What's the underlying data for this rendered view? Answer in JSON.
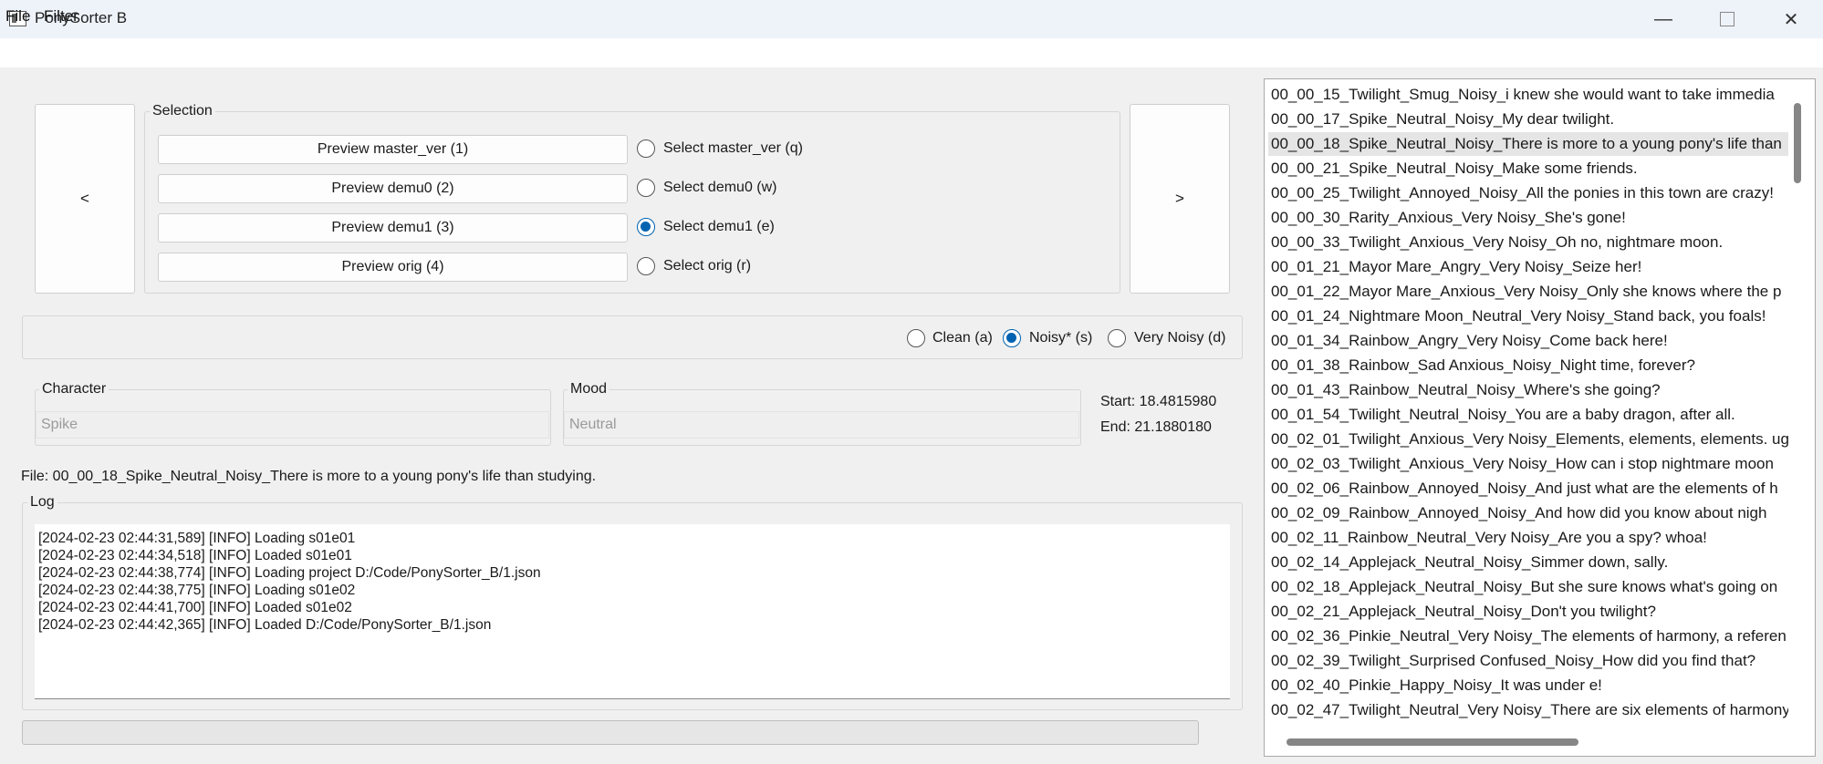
{
  "window": {
    "title": "PonySorter B",
    "min_glyph": "—",
    "close_glyph": "✕"
  },
  "menu": [
    "File",
    "Filter"
  ],
  "nav": {
    "prev": "<",
    "next": ">"
  },
  "selection": {
    "title": "Selection",
    "rows": [
      {
        "preview": "Preview master_ver (1)",
        "select": "Select master_ver (q)",
        "selected": false
      },
      {
        "preview": "Preview demu0 (2)",
        "select": "Select demu0 (w)",
        "selected": false
      },
      {
        "preview": "Preview demu1 (3)",
        "select": "Select demu1 (e)",
        "selected": true
      },
      {
        "preview": "Preview orig (4)",
        "select": "Select orig (r)",
        "selected": false
      }
    ]
  },
  "noise": {
    "options": [
      {
        "label": "Clean (a)",
        "selected": false
      },
      {
        "label": "Noisy* (s)",
        "selected": true
      },
      {
        "label": "Very Noisy (d)",
        "selected": false
      }
    ]
  },
  "character": {
    "label": "Character",
    "placeholder": "Spike"
  },
  "mood": {
    "label": "Mood",
    "placeholder": "Neutral"
  },
  "timing": {
    "start": "Start: 18.4815980",
    "end": "End: 21.1880180"
  },
  "file_label": "File: 00_00_18_Spike_Neutral_Noisy_There is more to a young pony's life than studying.",
  "log": {
    "title": "Log",
    "lines": [
      "[2024-02-23 02:44:31,589] [INFO] Loading s01e01",
      "[2024-02-23 02:44:34,518] [INFO] Loaded s01e01",
      "[2024-02-23 02:44:38,774] [INFO] Loading project D:/Code/PonySorter_B/1.json",
      "[2024-02-23 02:44:38,775] [INFO] Loading s01e02",
      "[2024-02-23 02:44:41,700] [INFO] Loaded s01e02",
      "[2024-02-23 02:44:42,365] [INFO] Loaded D:/Code/PonySorter_B/1.json"
    ]
  },
  "files": {
    "selected_index": 2,
    "items": [
      "00_00_15_Twilight_Smug_Noisy_i knew she would want to take immedia",
      "00_00_17_Spike_Neutral_Noisy_My dear twilight.",
      "00_00_18_Spike_Neutral_Noisy_There is more to a young pony's life than",
      "00_00_21_Spike_Neutral_Noisy_Make some friends.",
      "00_00_25_Twilight_Annoyed_Noisy_All the ponies in this town are crazy!",
      "00_00_30_Rarity_Anxious_Very Noisy_She's gone!",
      "00_00_33_Twilight_Anxious_Very Noisy_Oh no, nightmare moon.",
      "00_01_21_Mayor Mare_Angry_Very Noisy_Seize her!",
      "00_01_22_Mayor Mare_Anxious_Very Noisy_Only she knows where the p",
      "00_01_24_Nightmare Moon_Neutral_Very Noisy_Stand back, you foals!",
      "00_01_34_Rainbow_Angry_Very Noisy_Come back here!",
      "00_01_38_Rainbow_Sad Anxious_Noisy_Night time, forever?",
      "00_01_43_Rainbow_Neutral_Noisy_Where's she going?",
      "00_01_54_Twilight_Neutral_Noisy_You are a baby dragon, after all.",
      "00_02_01_Twilight_Anxious_Very Noisy_Elements, elements, elements. ug",
      "00_02_03_Twilight_Anxious_Very Noisy_How can i stop nightmare moon",
      "00_02_06_Rainbow_Annoyed_Noisy_And just what are the elements of h",
      "00_02_09_Rainbow_Annoyed_Noisy_And how did you know about nigh",
      "00_02_11_Rainbow_Neutral_Very Noisy_Are you a spy? whoa!",
      "00_02_14_Applejack_Neutral_Noisy_Simmer down, sally.",
      "00_02_18_Applejack_Neutral_Noisy_But she sure knows what's going on",
      "00_02_21_Applejack_Neutral_Noisy_Don't you twilight?",
      "00_02_36_Pinkie_Neutral_Very Noisy_The elements of harmony, a referen",
      "00_02_39_Twilight_Surprised Confused_Noisy_How did you find that?",
      "00_02_40_Pinkie_Happy_Noisy_It was under e!",
      "00_02_47_Twilight_Neutral_Very Noisy_There are six elements of harmony"
    ]
  }
}
